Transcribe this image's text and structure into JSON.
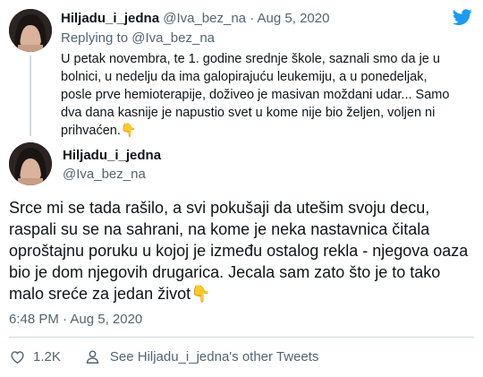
{
  "reply_tweet": {
    "display_name": "Hiljadu_i_jedna",
    "handle": "@Iva_bez_na",
    "separator": "·",
    "date": "Aug 5, 2020",
    "replying_to": "Replying to @Iva_bez_na",
    "text": "U petak novembra, te 1. godine srednje škole, saznali smo da je u bolnici, u nedelju da ima galopirajuću leukemiju, a u ponedeljak, posle prve hemioterapije, doživeo je masivan moždani udar... Samo dva dana kasnije je napustio svet u kome nije bio željen, voljen ni prihvaćen.",
    "emoji": "👇"
  },
  "main_tweet": {
    "display_name": "Hiljadu_i_jedna",
    "handle": "@Iva_bez_na",
    "text": "Srce mi se tada rašilo, a svi pokušaji da utešim svoju decu, raspali su se na sahrani, na kome je neka nastavnica  čitala oproštajnu poruku u kojoj je između ostalog rekla - njegova oaza bio je dom njegovih drugarica. Jecala sam zato što je to tako malo sreće za jedan život",
    "emoji": "👇",
    "timestamp": "6:48 PM · Aug 5, 2020",
    "like_count": "1.2K",
    "other_tweets_label": "See Hiljadu_i_jedna's other Tweets"
  },
  "icons": {
    "brand": "twitter-bird-icon",
    "like": "heart-icon",
    "more": "person-icon"
  },
  "colors": {
    "brand_blue": "#1d9bf0",
    "text_primary": "#0f1419",
    "text_muted": "#536471",
    "divider": "#cfd9de"
  }
}
